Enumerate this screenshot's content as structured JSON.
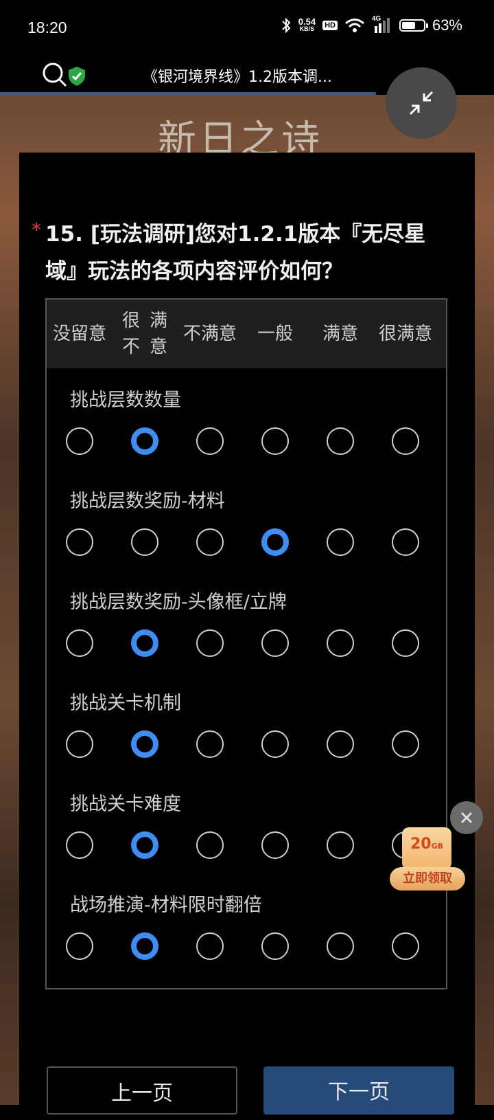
{
  "status_bar": {
    "time": "18:20",
    "net_speed_value": "0.54",
    "net_speed_unit": "KB/S",
    "hd_label": "HD",
    "signal_label": "4G",
    "battery_level": 0.63,
    "battery_percent": "63%"
  },
  "browser": {
    "title": "《银河境界线》1.2版本调..."
  },
  "banner_art_text": "新日之诗",
  "question": {
    "required_mark": "*",
    "title": "15. [玩法调研]您对1.2.1版本『无尽星域』玩法的各项内容评价如何？",
    "columns": [
      {
        "line1": "没留",
        "line2": "意"
      },
      {
        "line1": "很不",
        "line2": "满意"
      },
      {
        "line1": "不满",
        "line2": "意"
      },
      {
        "line1": "一般",
        "line2": ""
      },
      {
        "line1": "满意",
        "line2": ""
      },
      {
        "line1": "很满",
        "line2": "意"
      }
    ],
    "rows": [
      {
        "label": "挑战层数数量",
        "selected": 1
      },
      {
        "label": "挑战层数奖励-材料",
        "selected": 3
      },
      {
        "label": "挑战层数奖励-头像框/立牌",
        "selected": 1
      },
      {
        "label": "挑战关卡机制",
        "selected": 1
      },
      {
        "label": "挑战关卡难度",
        "selected": 1
      },
      {
        "label": "战场推演-材料限时翻倍",
        "selected": 1
      }
    ]
  },
  "promo": {
    "amount": "20",
    "unit": "GB",
    "claim_label": "立即领取"
  },
  "nav": {
    "prev_label": "上一页",
    "next_label": "下一页"
  },
  "colors": {
    "accent": "#3f8cf2",
    "required": "#e0463c",
    "next_button": "#264b7a"
  }
}
